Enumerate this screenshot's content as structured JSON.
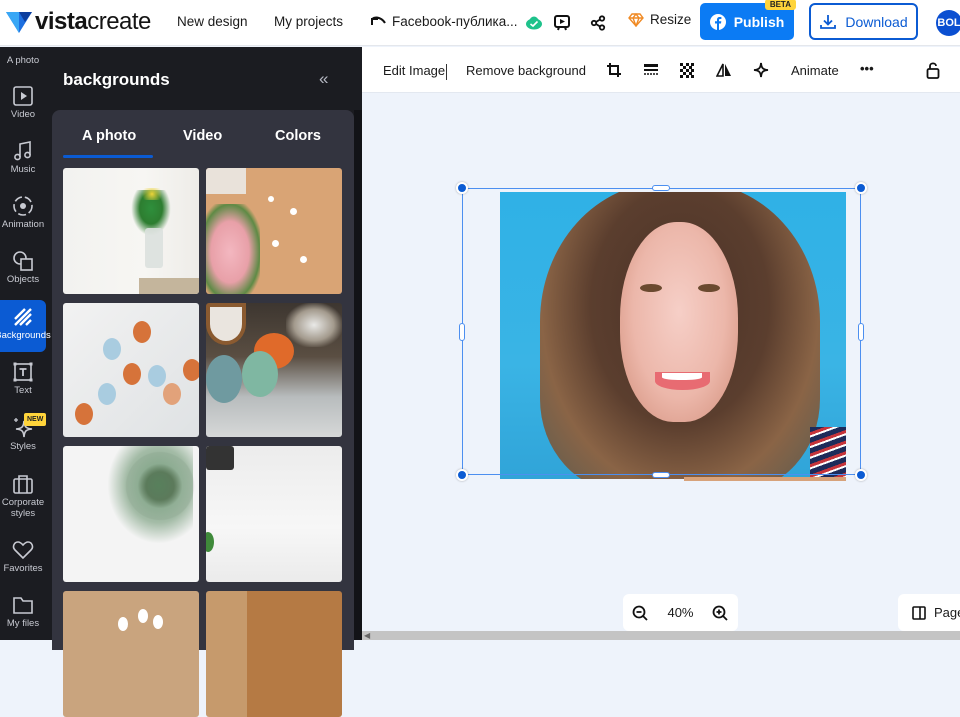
{
  "header": {
    "logo_bold": "vista",
    "logo_light": "create",
    "nav": [
      "New design",
      "My projects"
    ],
    "project_name": "Facebook-публика...",
    "resize_label": "Resize",
    "publish_label": "Publish",
    "publish_badge": "BETA",
    "download_label": "Download",
    "avatar_initials": "BOL",
    "colors": {
      "accent": "#0b7bf4",
      "download_border": "#0b5bd3",
      "sync_ok": "#1ec28b",
      "resize_icon": "#f08a24"
    }
  },
  "leftbar": {
    "items": [
      {
        "label": "A photo",
        "icon": "photo-icon"
      },
      {
        "label": "Video",
        "icon": "video-icon"
      },
      {
        "label": "Music",
        "icon": "music-icon"
      },
      {
        "label": "Animation",
        "icon": "animation-icon"
      },
      {
        "label": "Objects",
        "icon": "objects-icon"
      },
      {
        "label": "Backgrounds",
        "icon": "backgrounds-icon",
        "active": true
      },
      {
        "label": "Text",
        "icon": "text-icon"
      },
      {
        "label": "Styles",
        "icon": "styles-icon",
        "badge": "NEW"
      },
      {
        "label": "Corporate styles",
        "icon": "briefcase-icon"
      },
      {
        "label": "Favorites",
        "icon": "heart-icon"
      },
      {
        "label": "My files",
        "icon": "folder-icon"
      }
    ]
  },
  "panel": {
    "title": "backgrounds",
    "collapse_glyph": "«",
    "tabs": [
      {
        "label": "A photo",
        "active": true
      },
      {
        "label": "Video"
      },
      {
        "label": "Colors"
      }
    ],
    "thumbnails": [
      "tulips-in-vase",
      "pink-flowers-on-peach",
      "pastel-easter-eggs",
      "decorated-easter-eggs",
      "potted-plant-on-white",
      "white-wood-with-camera",
      "white-tulips-on-kraft",
      "wooden-board-with-fabric"
    ]
  },
  "toolbar": {
    "edit_image": "Edit Image",
    "remove_background": "Remove background",
    "animate": "Animate",
    "more": "•••",
    "icons": [
      "crop-icon",
      "transparency-icon",
      "filter-icon",
      "flip-icon",
      "effects-icon",
      "lock-icon"
    ]
  },
  "canvas": {
    "zoom_level": "40%",
    "page_label": "Page"
  }
}
